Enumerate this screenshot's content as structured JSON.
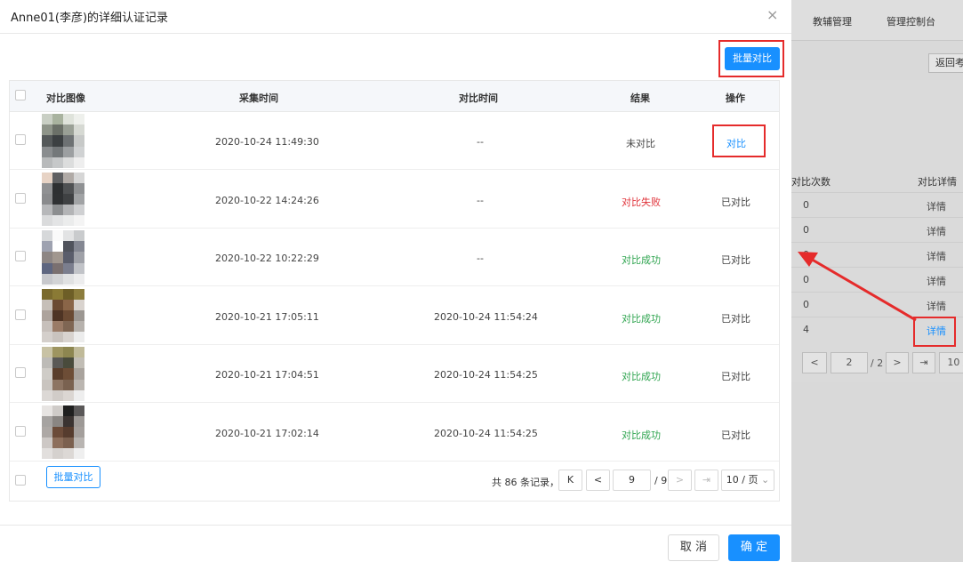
{
  "background": {
    "nav": [
      "教辅管理",
      "管理控制台"
    ],
    "return_label": "返回考",
    "table_headers": [
      "对比次数",
      "对比详情"
    ],
    "rows": [
      {
        "count": "0",
        "detail": "详情"
      },
      {
        "count": "0",
        "detail": "详情"
      },
      {
        "count": "0",
        "detail": "详情"
      },
      {
        "count": "0",
        "detail": "详情"
      },
      {
        "count": "0",
        "detail": "详情"
      },
      {
        "count": "4",
        "detail": "详情"
      }
    ],
    "pager": {
      "page": "2",
      "total": "/ 2",
      "size": "10 /"
    }
  },
  "modal": {
    "title": "Anne01(李彦)的详细认证记录",
    "close": "×",
    "batch_compare_top": "批量对比",
    "batch_compare_bottom": "批量对比",
    "headers": [
      "对比图像",
      "采集时间",
      "对比时间",
      "结果",
      "操作"
    ],
    "rows": [
      {
        "collect_time": "2020-10-24 11:49:30",
        "compare_time": "--",
        "result": "未对比",
        "result_status": "none",
        "action": "对比",
        "action_link": true
      },
      {
        "collect_time": "2020-10-22 14:24:26",
        "compare_time": "--",
        "result": "对比失败",
        "result_status": "fail",
        "action": "已对比",
        "action_link": false
      },
      {
        "collect_time": "2020-10-22 10:22:29",
        "compare_time": "--",
        "result": "对比成功",
        "result_status": "ok",
        "action": "已对比",
        "action_link": false
      },
      {
        "collect_time": "2020-10-21 17:05:11",
        "compare_time": "2020-10-24 11:54:24",
        "result": "对比成功",
        "result_status": "ok",
        "action": "已对比",
        "action_link": false
      },
      {
        "collect_time": "2020-10-21 17:04:51",
        "compare_time": "2020-10-24 11:54:25",
        "result": "对比成功",
        "result_status": "ok",
        "action": "已对比",
        "action_link": false
      },
      {
        "collect_time": "2020-10-21 17:02:14",
        "compare_time": "2020-10-24 11:54:25",
        "result": "对比成功",
        "result_status": "ok",
        "action": "已对比",
        "action_link": false
      }
    ],
    "pager": {
      "total_text": "共 86 条记录，",
      "first": "K",
      "prev": "<",
      "page": "9",
      "total_pages": "/ 9",
      "next": ">",
      "last": "⇥",
      "size": "10 / 页"
    },
    "cancel": "取 消",
    "confirm": "确 定"
  },
  "colors": {
    "primary": "#1890ff",
    "fail": "#e0333a",
    "success": "#2ea44f",
    "annotation": "#e52b2b"
  }
}
